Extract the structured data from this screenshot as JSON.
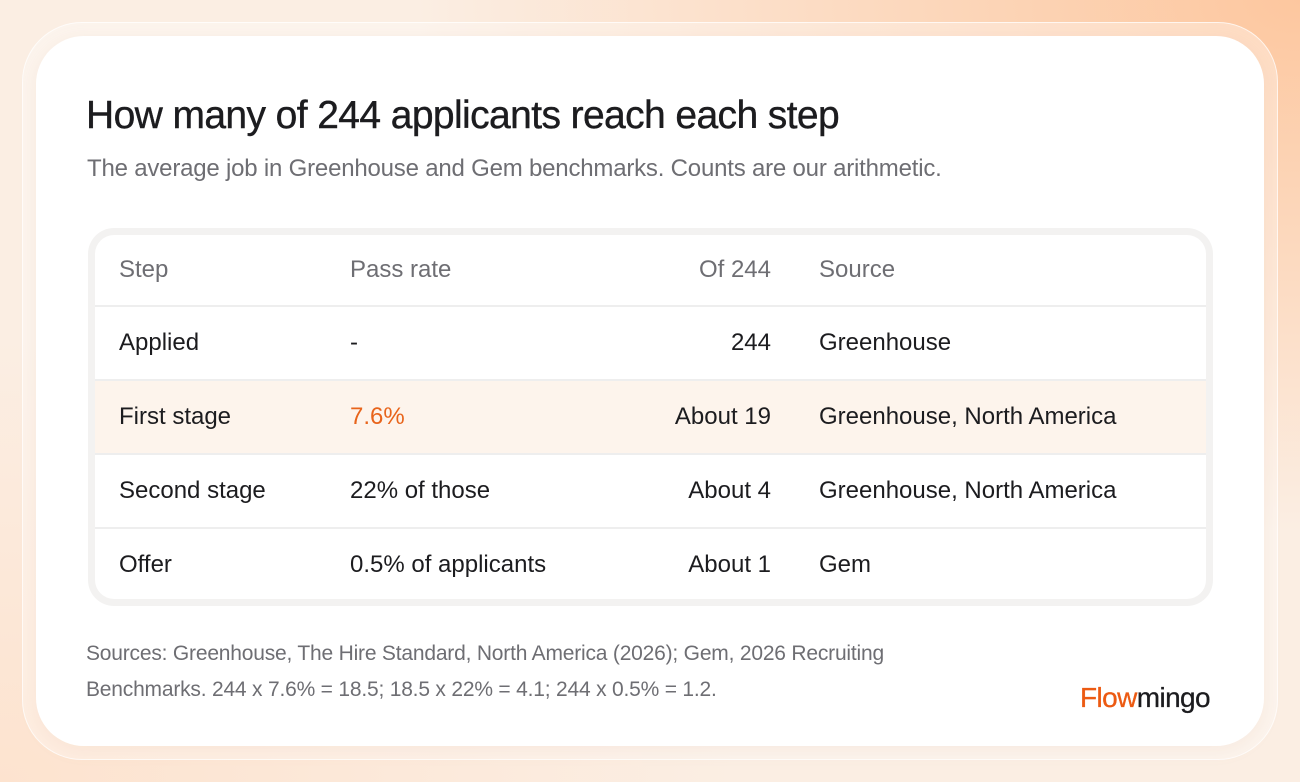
{
  "title": "How many of 244 applicants reach each step",
  "subtitle": "The average job in Greenhouse and Gem benchmarks. Counts are our arithmetic.",
  "table": {
    "headers": {
      "step": "Step",
      "pass_rate": "Pass rate",
      "count": "Of 244",
      "source": "Source"
    },
    "rows": [
      {
        "step": "Applied",
        "pass_rate": "-",
        "count": "244",
        "source": "Greenhouse"
      },
      {
        "step": "First stage",
        "pass_rate": "7.6%",
        "count": "About 19",
        "source": "Greenhouse, North America",
        "highlighted": true
      },
      {
        "step": "Second stage",
        "pass_rate": "22% of those",
        "count": "About 4",
        "source": "Greenhouse, North America"
      },
      {
        "step": "Offer",
        "pass_rate": "0.5% of applicants",
        "count": "About 1",
        "source": "Gem"
      }
    ]
  },
  "footnote": {
    "line1": "Sources: Greenhouse, The Hire Standard, North America (2026); Gem, 2026 Recruiting",
    "line2": "Benchmarks. 244 x 7.6% = 18.5; 18.5 x 22% = 4.1; 244 x 0.5% = 1.2."
  },
  "brand": {
    "part1": "Flow",
    "part2": "mingo"
  },
  "colors": {
    "accent": "#e8641b",
    "highlight_row": "#fdf4ec",
    "text": "#1c1c1f",
    "muted_text": "#6e6e73"
  }
}
